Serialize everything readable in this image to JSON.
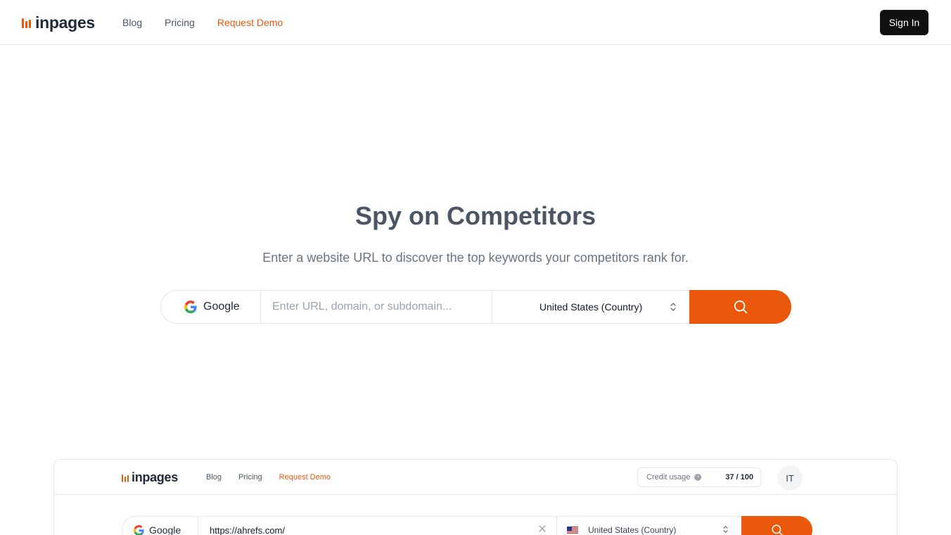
{
  "nav": {
    "logo_text": "inpages",
    "links": [
      {
        "label": "Blog"
      },
      {
        "label": "Pricing"
      },
      {
        "label": "Request Demo"
      }
    ],
    "sign_in_label": "Sign In"
  },
  "hero": {
    "title": "Spy on Competitors",
    "subtitle": "Enter a website URL to discover the top keywords your competitors rank for."
  },
  "search": {
    "engine_label": "Google",
    "url_placeholder": "Enter URL, domain, or subdomain...",
    "url_value": "",
    "country_label": "United States (Country)"
  },
  "preview": {
    "logo_text": "inpages",
    "links": [
      "Blog",
      "Pricing",
      "Request Demo"
    ],
    "credit_label": "Credit usage",
    "credit_value": "37 / 100",
    "avatar_initials": "IT",
    "engine_label": "Google",
    "url_value": "https://ahrefs.com/",
    "country_label": "United States (Country)"
  },
  "colors": {
    "accent": "#ea580c",
    "dark_button": "#111111",
    "border": "#e5e7eb",
    "heading": "#4b5563",
    "muted_text": "#6b7280"
  },
  "icons": {
    "engine": "google-g-icon",
    "search": "search-icon",
    "country_select": "chevron-up-down-icon",
    "clear": "close-icon",
    "flag": "us-flag-icon",
    "credit_info": "info-icon"
  }
}
